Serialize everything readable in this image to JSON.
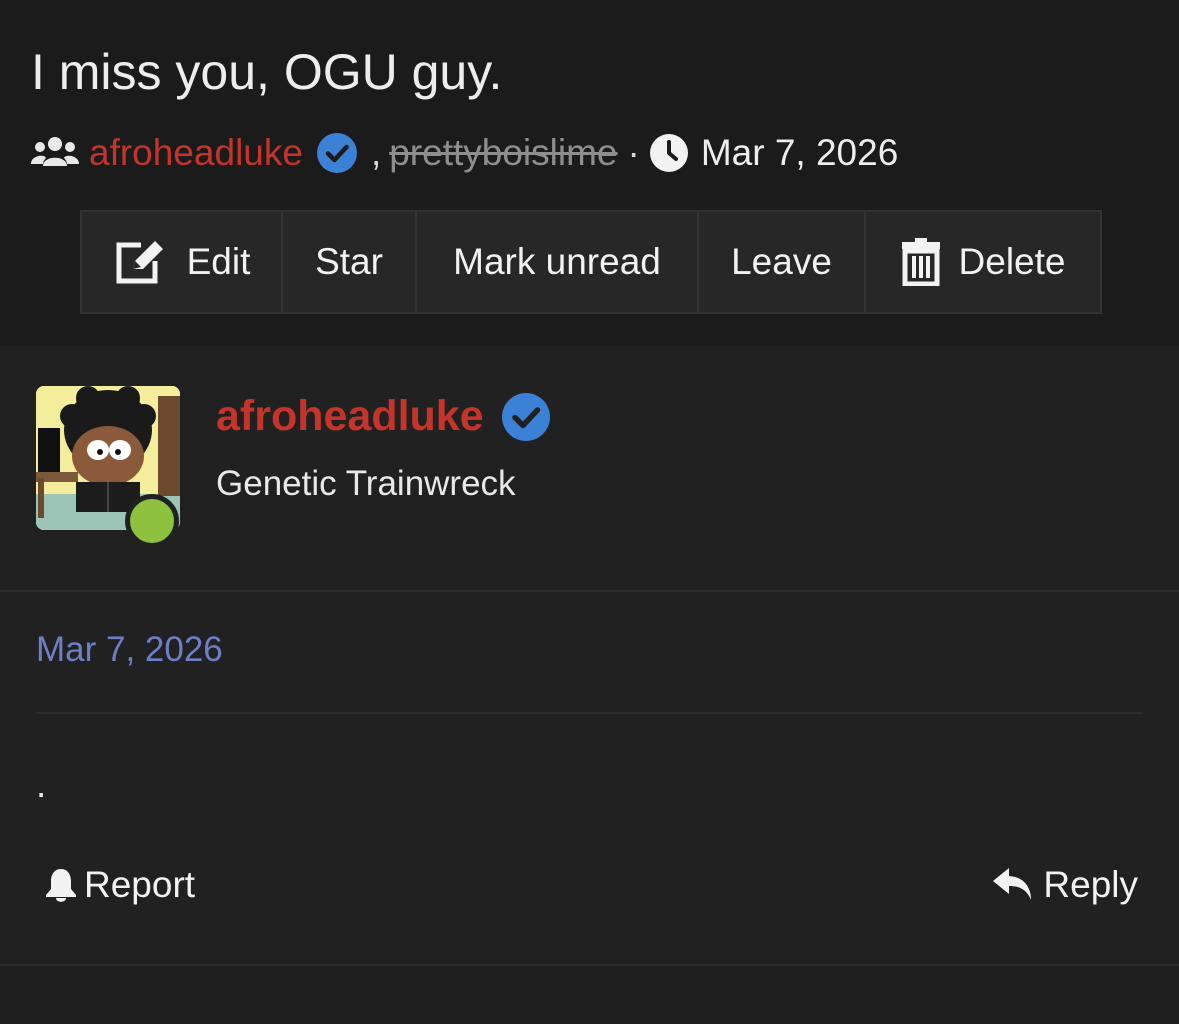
{
  "conversation": {
    "title": "I miss you, OGU guy.",
    "participants_icon": "users-icon",
    "participants": [
      {
        "name": "afroheadluke",
        "verified": true,
        "color": "#c5342a"
      },
      {
        "name": "prettyboislime",
        "left": true
      }
    ],
    "separator_comma": ",",
    "separator_dot": "·",
    "clock_icon": "clock-icon",
    "date": "Mar 7, 2026"
  },
  "toolbar": {
    "edit_label": "Edit",
    "star_label": "Star",
    "mark_unread_label": "Mark unread",
    "leave_label": "Leave",
    "delete_label": "Delete"
  },
  "message": {
    "author": {
      "name": "afroheadluke",
      "verified": true,
      "title": "Genetic Trainwreck",
      "online": true
    },
    "date": "Mar 7, 2026",
    "body": ".",
    "actions": {
      "report_label": "Report",
      "reply_label": "Reply"
    }
  },
  "colors": {
    "accent_red": "#c5342a",
    "verified_blue": "#3b82d6",
    "date_link": "#6d7fc6",
    "online_green": "#8ec13d"
  }
}
